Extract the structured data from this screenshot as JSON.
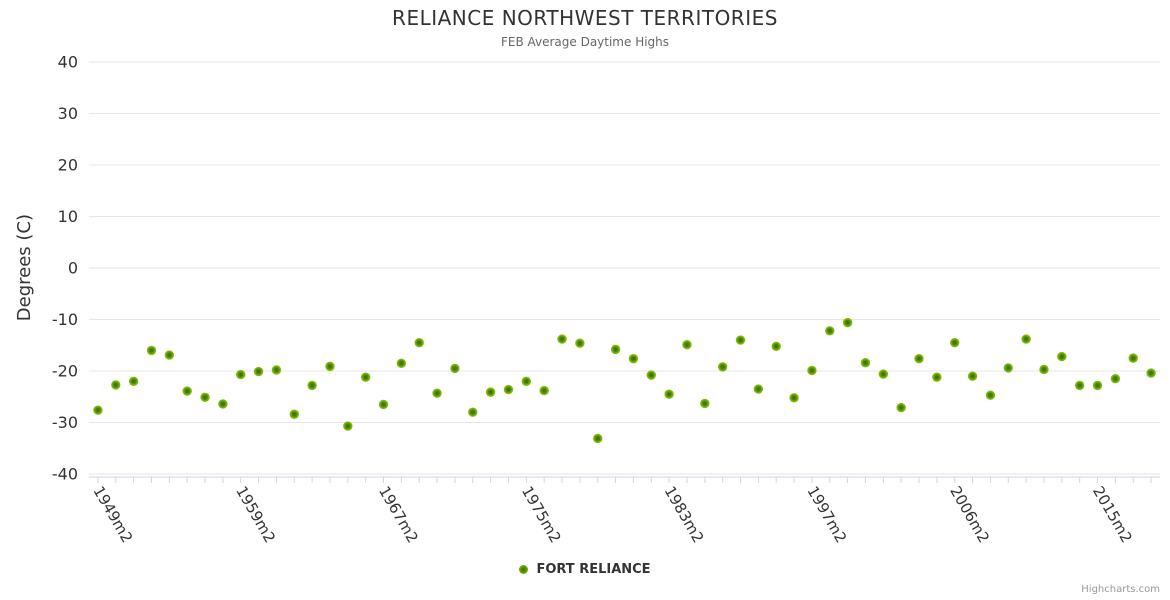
{
  "title": "RELIANCE NORTHWEST TERRITORIES",
  "subtitle": "FEB Average Daytime Highs",
  "y_axis_title": "Degrees (C)",
  "legend": {
    "label": "FORT RELIANCE"
  },
  "credit": "Highcharts.com",
  "colors": {
    "point": "#77b300",
    "point_core": "#3a6600",
    "point_rim": "#83c213",
    "grid": "#e6e6e6",
    "axis": "#ccd6eb",
    "title_text": "#333333",
    "subtitle_text": "#666666",
    "label_text": "#333333",
    "credit_text": "#999999"
  },
  "chart_data": {
    "type": "scatter",
    "title": "RELIANCE NORTHWEST TERRITORIES",
    "subtitle": "FEB Average Daytime Highs",
    "xlabel": "",
    "ylabel": "Degrees (C)",
    "ylim": [
      -40,
      40
    ],
    "ytick_step": 10,
    "grid": true,
    "legend_position": "bottom-center",
    "y_tick_labels": [
      "40",
      "30",
      "20",
      "10",
      "0",
      "-10",
      "-20",
      "-30",
      "-40"
    ],
    "x_tick_labels": [
      {
        "index": 0,
        "label": "1949m2"
      },
      {
        "index": 8,
        "label": "1959m2"
      },
      {
        "index": 16,
        "label": "1967m2"
      },
      {
        "index": 24,
        "label": "1975m2"
      },
      {
        "index": 32,
        "label": "1983m2"
      },
      {
        "index": 40,
        "label": "1997m2"
      },
      {
        "index": 48,
        "label": "2006m2"
      },
      {
        "index": 56,
        "label": "2015m2"
      }
    ],
    "series": [
      {
        "name": "FORT RELIANCE",
        "color": "#77b300",
        "values": [
          -27.6,
          -22.7,
          -22.0,
          -16.0,
          -16.9,
          -23.9,
          -25.1,
          -26.4,
          -20.7,
          -20.1,
          -19.8,
          -28.4,
          -22.8,
          -19.1,
          -30.7,
          -21.2,
          -26.5,
          -18.5,
          -14.5,
          -24.3,
          -19.5,
          -28.0,
          -24.1,
          -23.6,
          -22.0,
          -23.8,
          -13.8,
          -14.6,
          -33.1,
          -15.8,
          -17.6,
          -20.8,
          -24.5,
          -14.9,
          -26.3,
          -19.2,
          -14.0,
          -23.5,
          -15.2,
          -25.2,
          -19.9,
          -12.2,
          -10.6,
          -18.4,
          -20.6,
          -27.1,
          -17.6,
          -21.2,
          -14.5,
          -21.0,
          -24.7,
          -19.4,
          -13.8,
          -19.7,
          -17.2,
          -22.8,
          -22.8,
          -21.5,
          -17.5,
          -20.4
        ]
      }
    ]
  }
}
